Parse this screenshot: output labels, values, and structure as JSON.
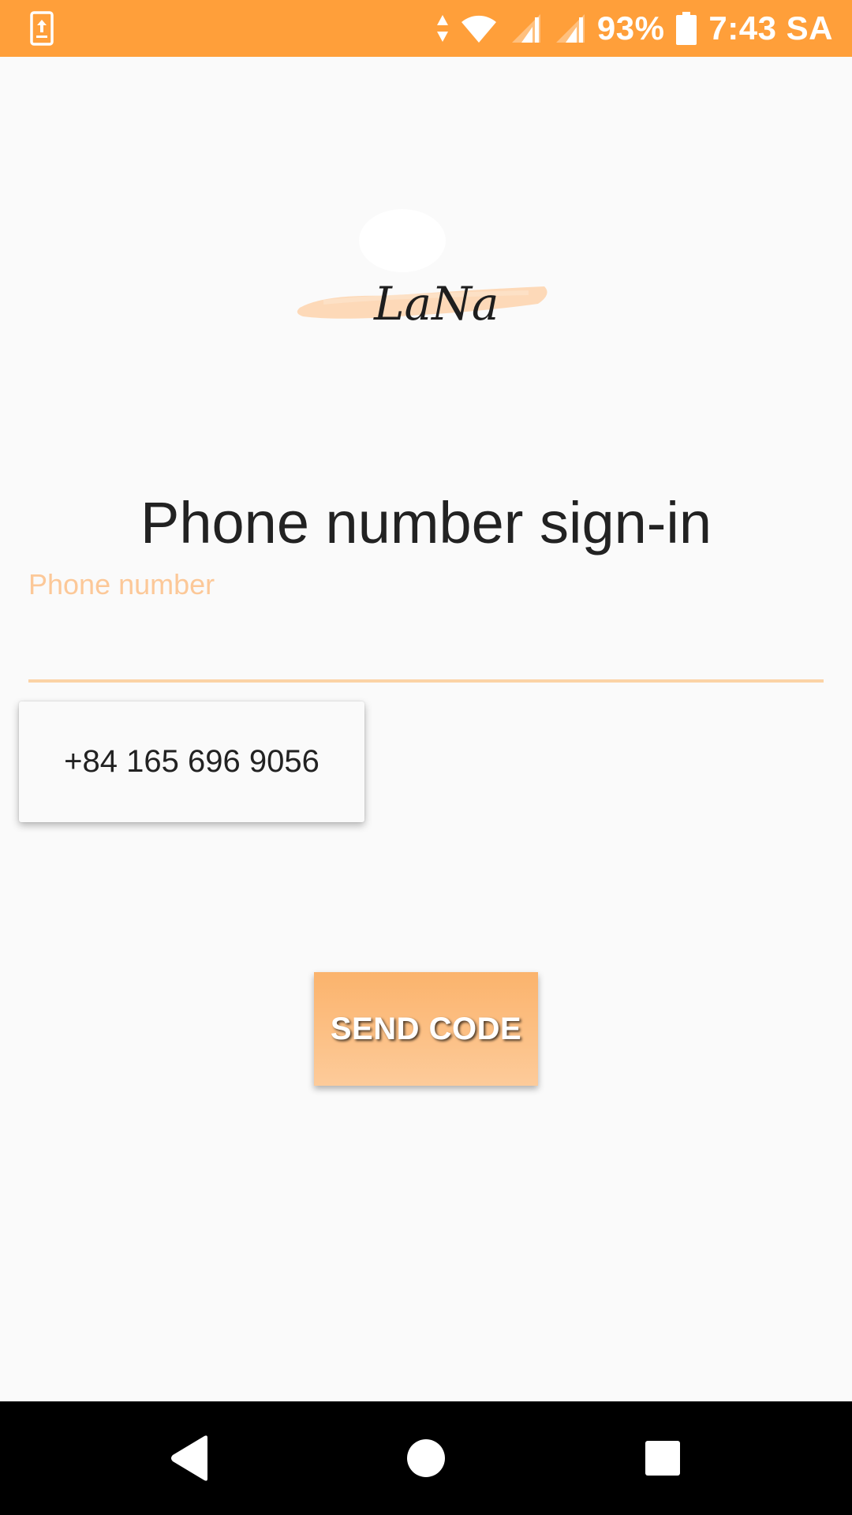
{
  "status_bar": {
    "battery": "93%",
    "time": "7:43 SA",
    "icons": [
      "screen-share-icon",
      "data-arrows-icon",
      "wifi-icon",
      "signal-icon",
      "signal-icon",
      "battery-icon"
    ]
  },
  "logo": {
    "text": "LaNa",
    "brush_color": "#fdd9b8"
  },
  "title": "Phone number sign-in",
  "phone_field": {
    "label": "Phone number",
    "value": ""
  },
  "suggestion": {
    "text": "+84 165 696 9056"
  },
  "send_button": {
    "label": "SEND CODE"
  },
  "nav_bar": {
    "items": [
      "back-icon",
      "home-icon",
      "recents-icon"
    ]
  },
  "colors": {
    "accent": "#ff9f3a",
    "label": "#fcc898",
    "underline": "#fbd3a6"
  }
}
